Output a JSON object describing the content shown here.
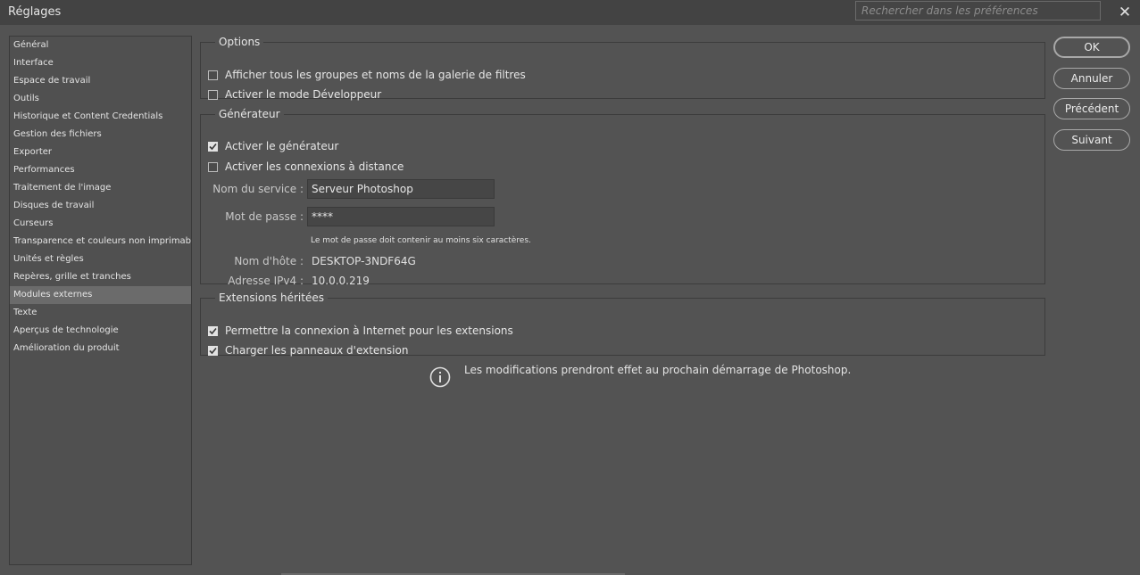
{
  "window": {
    "title": "Réglages",
    "close_glyph": "✕"
  },
  "search": {
    "placeholder": "Rechercher dans les préférences",
    "value": ""
  },
  "sidebar": {
    "selected_index": 15,
    "items": [
      "Général",
      "Interface",
      "Espace de travail",
      "Outils",
      "Historique et Content Credentials",
      "Gestion des fichiers",
      "Exporter",
      "Performances",
      "Traitement de l'image",
      "Disques de travail",
      "Curseurs",
      "Transparence et couleurs non imprimables",
      "Unités et règles",
      "Repères, grille et tranches",
      "Modules externes",
      "Texte",
      "Aperçus de technologie",
      "Amélioration du produit"
    ]
  },
  "options": {
    "legend": "Options",
    "checkboxes": [
      {
        "label": "Afficher tous les groupes et noms de la galerie de filtres",
        "checked": false
      },
      {
        "label": "Activer le mode Développeur",
        "checked": false
      }
    ]
  },
  "generator": {
    "legend": "Générateur",
    "checkboxes": [
      {
        "label": "Activer le générateur",
        "checked": true
      },
      {
        "label": "Activer les connexions à distance",
        "checked": false
      }
    ],
    "service_name": {
      "label": "Nom du service :",
      "value": "Serveur Photoshop"
    },
    "password": {
      "label": "Mot de passe :",
      "value": "****"
    },
    "password_hint": "Le mot de passe doit contenir au moins six caractères.",
    "hostname": {
      "label": "Nom d'hôte :",
      "value": "DESKTOP-3NDF64G"
    },
    "ipv4": {
      "label": "Adresse IPv4 :",
      "value": "10.0.0.219"
    }
  },
  "extensions": {
    "legend": "Extensions héritées",
    "checkboxes": [
      {
        "label": "Permettre la connexion à Internet pour les extensions",
        "checked": true
      },
      {
        "label": "Charger les panneaux d'extension",
        "checked": true
      }
    ]
  },
  "info": {
    "icon": "info-icon",
    "text": "Les modifications prendront effet au prochain démarrage de Photoshop."
  },
  "buttons": {
    "ok": "OK",
    "cancel": "Annuler",
    "previous": "Précédent",
    "next": "Suivant"
  },
  "colors": {
    "background": "#535353",
    "titlebar": "#434343",
    "selected_item": "#6b6b6b",
    "checkbox_checked": "#e2e2e2"
  }
}
